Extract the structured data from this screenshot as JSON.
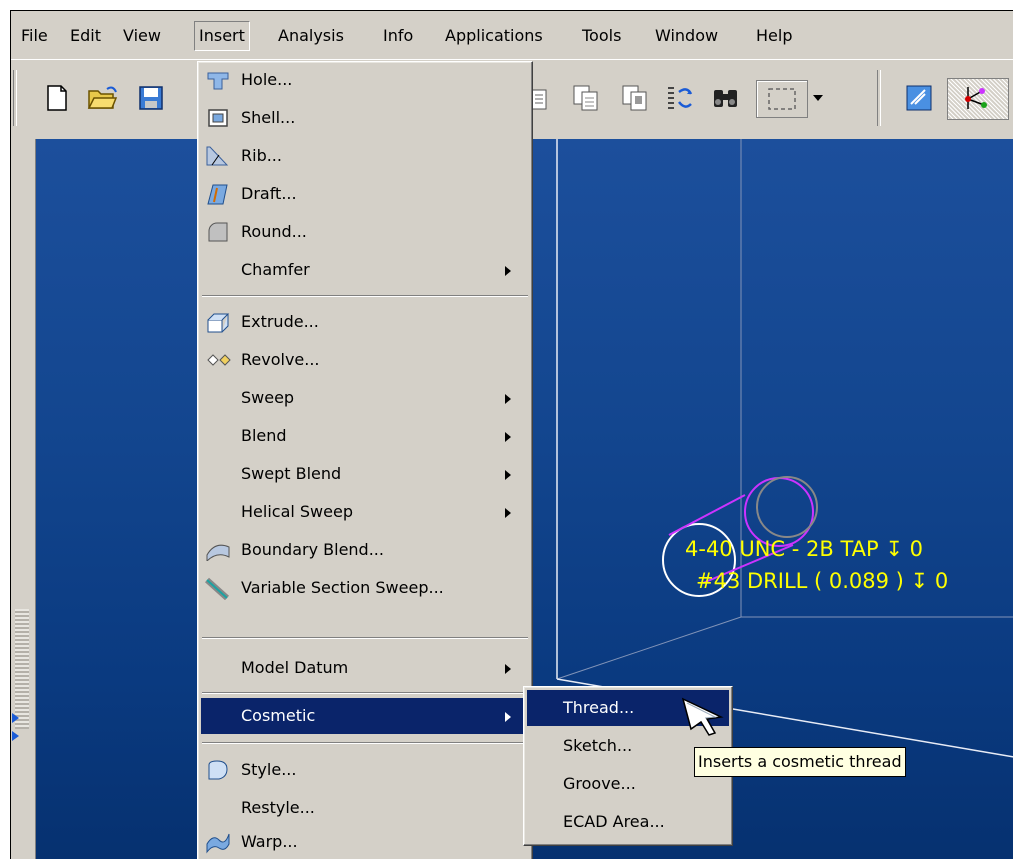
{
  "menubar": {
    "items": [
      "File",
      "Edit",
      "View",
      "Insert",
      "Analysis",
      "Info",
      "Applications",
      "Tools",
      "Window",
      "Help"
    ]
  },
  "insert_menu": {
    "items": [
      {
        "label": "Hole...",
        "icon": "hole-icon"
      },
      {
        "label": "Shell...",
        "icon": "shell-icon"
      },
      {
        "label": "Rib...",
        "icon": "rib-icon"
      },
      {
        "label": "Draft...",
        "icon": "draft-icon"
      },
      {
        "label": "Round...",
        "icon": "round-icon"
      },
      {
        "label": "Chamfer",
        "icon": "",
        "submenu": true
      },
      {
        "label": "Extrude...",
        "icon": "extrude-icon"
      },
      {
        "label": "Revolve...",
        "icon": "revolve-icon"
      },
      {
        "label": "Sweep",
        "icon": "",
        "submenu": true
      },
      {
        "label": "Blend",
        "icon": "",
        "submenu": true
      },
      {
        "label": "Swept Blend",
        "icon": "",
        "submenu": true
      },
      {
        "label": "Helical Sweep",
        "icon": "",
        "submenu": true
      },
      {
        "label": "Boundary Blend...",
        "icon": "boundary-blend-icon"
      },
      {
        "label": "Variable Section Sweep...",
        "icon": "variable-section-sweep-icon"
      },
      {
        "label": "Model Datum",
        "icon": "",
        "submenu": true
      },
      {
        "label": "Cosmetic",
        "icon": "",
        "submenu": true,
        "highlighted": true
      },
      {
        "label": "Style...",
        "icon": "style-icon"
      },
      {
        "label": "Restyle...",
        "icon": ""
      },
      {
        "label": "Warp...",
        "icon": "warp-icon"
      }
    ]
  },
  "cosmetic_submenu": {
    "items": [
      {
        "label": "Thread...",
        "highlighted": true
      },
      {
        "label": "Sketch..."
      },
      {
        "label": "Groove..."
      },
      {
        "label": "ECAD Area..."
      }
    ]
  },
  "tooltip": "Inserts a cosmetic thread",
  "viewport": {
    "annotation_line1": "4-40 UNC - 2B TAP ↧ 0",
    "annotation_line2": "#43 DRILL ( 0.089 ) ↧ 0"
  },
  "colors": {
    "menu_highlight": "#0a246a",
    "annotation": "#ffff00",
    "thread_geometry": "#cc33ff"
  }
}
